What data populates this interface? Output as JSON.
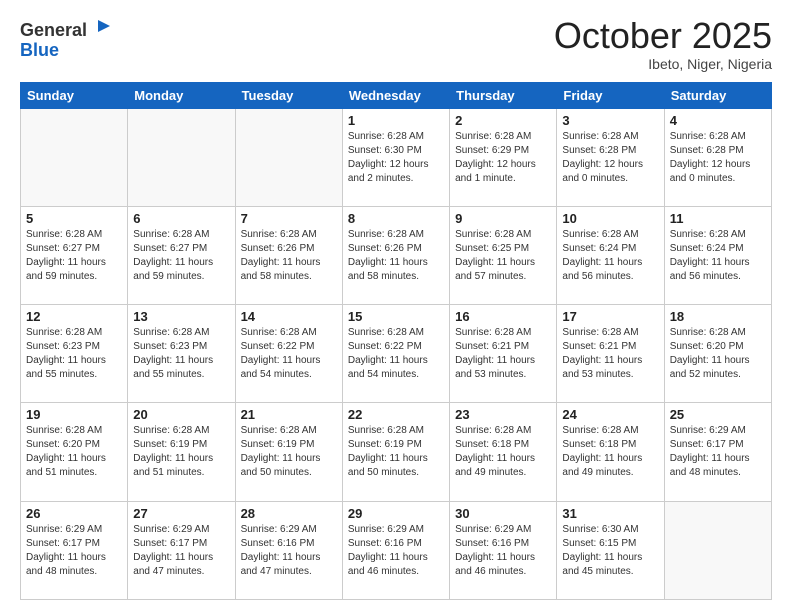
{
  "header": {
    "logo_general": "General",
    "logo_blue": "Blue",
    "month_title": "October 2025",
    "location": "Ibeto, Niger, Nigeria"
  },
  "days_of_week": [
    "Sunday",
    "Monday",
    "Tuesday",
    "Wednesday",
    "Thursday",
    "Friday",
    "Saturday"
  ],
  "weeks": [
    [
      {
        "day": "",
        "info": ""
      },
      {
        "day": "",
        "info": ""
      },
      {
        "day": "",
        "info": ""
      },
      {
        "day": "1",
        "info": "Sunrise: 6:28 AM\nSunset: 6:30 PM\nDaylight: 12 hours\nand 2 minutes."
      },
      {
        "day": "2",
        "info": "Sunrise: 6:28 AM\nSunset: 6:29 PM\nDaylight: 12 hours\nand 1 minute."
      },
      {
        "day": "3",
        "info": "Sunrise: 6:28 AM\nSunset: 6:28 PM\nDaylight: 12 hours\nand 0 minutes."
      },
      {
        "day": "4",
        "info": "Sunrise: 6:28 AM\nSunset: 6:28 PM\nDaylight: 12 hours\nand 0 minutes."
      }
    ],
    [
      {
        "day": "5",
        "info": "Sunrise: 6:28 AM\nSunset: 6:27 PM\nDaylight: 11 hours\nand 59 minutes."
      },
      {
        "day": "6",
        "info": "Sunrise: 6:28 AM\nSunset: 6:27 PM\nDaylight: 11 hours\nand 59 minutes."
      },
      {
        "day": "7",
        "info": "Sunrise: 6:28 AM\nSunset: 6:26 PM\nDaylight: 11 hours\nand 58 minutes."
      },
      {
        "day": "8",
        "info": "Sunrise: 6:28 AM\nSunset: 6:26 PM\nDaylight: 11 hours\nand 58 minutes."
      },
      {
        "day": "9",
        "info": "Sunrise: 6:28 AM\nSunset: 6:25 PM\nDaylight: 11 hours\nand 57 minutes."
      },
      {
        "day": "10",
        "info": "Sunrise: 6:28 AM\nSunset: 6:24 PM\nDaylight: 11 hours\nand 56 minutes."
      },
      {
        "day": "11",
        "info": "Sunrise: 6:28 AM\nSunset: 6:24 PM\nDaylight: 11 hours\nand 56 minutes."
      }
    ],
    [
      {
        "day": "12",
        "info": "Sunrise: 6:28 AM\nSunset: 6:23 PM\nDaylight: 11 hours\nand 55 minutes."
      },
      {
        "day": "13",
        "info": "Sunrise: 6:28 AM\nSunset: 6:23 PM\nDaylight: 11 hours\nand 55 minutes."
      },
      {
        "day": "14",
        "info": "Sunrise: 6:28 AM\nSunset: 6:22 PM\nDaylight: 11 hours\nand 54 minutes."
      },
      {
        "day": "15",
        "info": "Sunrise: 6:28 AM\nSunset: 6:22 PM\nDaylight: 11 hours\nand 54 minutes."
      },
      {
        "day": "16",
        "info": "Sunrise: 6:28 AM\nSunset: 6:21 PM\nDaylight: 11 hours\nand 53 minutes."
      },
      {
        "day": "17",
        "info": "Sunrise: 6:28 AM\nSunset: 6:21 PM\nDaylight: 11 hours\nand 53 minutes."
      },
      {
        "day": "18",
        "info": "Sunrise: 6:28 AM\nSunset: 6:20 PM\nDaylight: 11 hours\nand 52 minutes."
      }
    ],
    [
      {
        "day": "19",
        "info": "Sunrise: 6:28 AM\nSunset: 6:20 PM\nDaylight: 11 hours\nand 51 minutes."
      },
      {
        "day": "20",
        "info": "Sunrise: 6:28 AM\nSunset: 6:19 PM\nDaylight: 11 hours\nand 51 minutes."
      },
      {
        "day": "21",
        "info": "Sunrise: 6:28 AM\nSunset: 6:19 PM\nDaylight: 11 hours\nand 50 minutes."
      },
      {
        "day": "22",
        "info": "Sunrise: 6:28 AM\nSunset: 6:19 PM\nDaylight: 11 hours\nand 50 minutes."
      },
      {
        "day": "23",
        "info": "Sunrise: 6:28 AM\nSunset: 6:18 PM\nDaylight: 11 hours\nand 49 minutes."
      },
      {
        "day": "24",
        "info": "Sunrise: 6:28 AM\nSunset: 6:18 PM\nDaylight: 11 hours\nand 49 minutes."
      },
      {
        "day": "25",
        "info": "Sunrise: 6:29 AM\nSunset: 6:17 PM\nDaylight: 11 hours\nand 48 minutes."
      }
    ],
    [
      {
        "day": "26",
        "info": "Sunrise: 6:29 AM\nSunset: 6:17 PM\nDaylight: 11 hours\nand 48 minutes."
      },
      {
        "day": "27",
        "info": "Sunrise: 6:29 AM\nSunset: 6:17 PM\nDaylight: 11 hours\nand 47 minutes."
      },
      {
        "day": "28",
        "info": "Sunrise: 6:29 AM\nSunset: 6:16 PM\nDaylight: 11 hours\nand 47 minutes."
      },
      {
        "day": "29",
        "info": "Sunrise: 6:29 AM\nSunset: 6:16 PM\nDaylight: 11 hours\nand 46 minutes."
      },
      {
        "day": "30",
        "info": "Sunrise: 6:29 AM\nSunset: 6:16 PM\nDaylight: 11 hours\nand 46 minutes."
      },
      {
        "day": "31",
        "info": "Sunrise: 6:30 AM\nSunset: 6:15 PM\nDaylight: 11 hours\nand 45 minutes."
      },
      {
        "day": "",
        "info": ""
      }
    ]
  ]
}
